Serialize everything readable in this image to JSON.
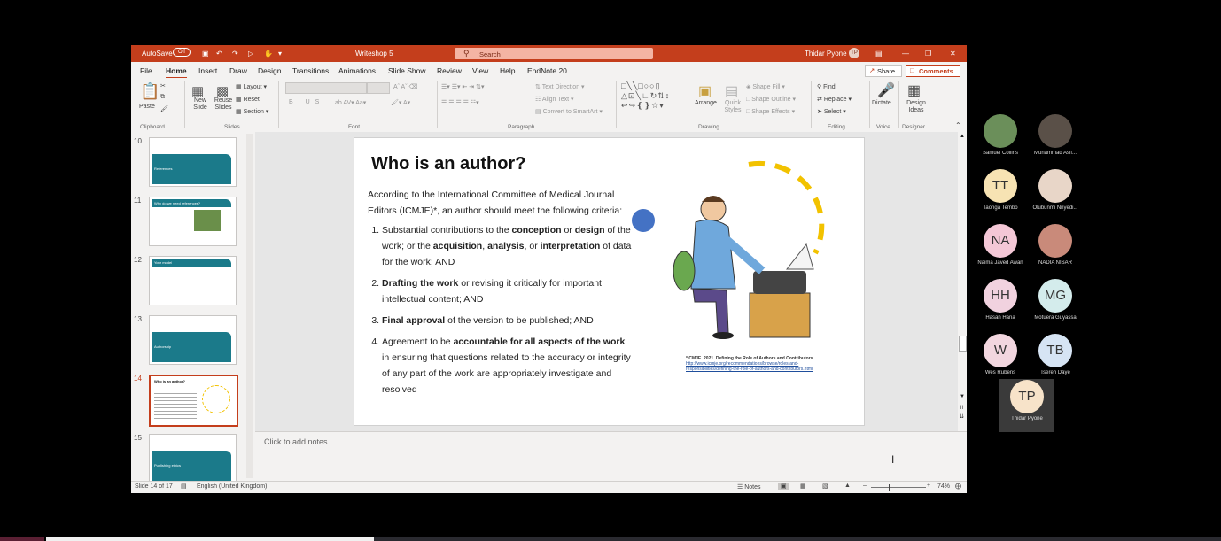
{
  "window": {
    "autosave_label": "AutoSave",
    "autosave_state": "Off",
    "doc_title": "Writeshop 5",
    "search_placeholder": "Search",
    "user_name": "Thidar Pyone",
    "user_initials": "TP"
  },
  "tabs": [
    "File",
    "Home",
    "Insert",
    "Draw",
    "Design",
    "Transitions",
    "Animations",
    "Slide Show",
    "Review",
    "View",
    "Help",
    "EndNote 20"
  ],
  "active_tab": "Home",
  "share_label": "Share",
  "comments_label": "Comments",
  "ribbon": {
    "paste": "Paste",
    "new_slide": "New Slide",
    "reuse_slides": "Reuse Slides",
    "layout": "Layout",
    "reset": "Reset",
    "section": "Section",
    "text_direction": "Text Direction",
    "align_text": "Align Text",
    "convert_smartart": "Convert to SmartArt",
    "arrange": "Arrange",
    "quick_styles": "Quick Styles",
    "shape_fill": "Shape Fill",
    "shape_outline": "Shape Outline",
    "shape_effects": "Shape Effects",
    "find": "Find",
    "replace": "Replace",
    "select": "Select",
    "dictate": "Dictate",
    "design_ideas": "Design Ideas",
    "groups": [
      "Clipboard",
      "Slides",
      "Font",
      "Paragraph",
      "Drawing",
      "Editing",
      "Voice",
      "Designer"
    ]
  },
  "thumbnails": [
    {
      "num": "10",
      "title": "References"
    },
    {
      "num": "11",
      "title": "Why do we need references?"
    },
    {
      "num": "12",
      "title": "Your model"
    },
    {
      "num": "13",
      "title": "Authorship"
    },
    {
      "num": "14",
      "title": "Who is an author?"
    },
    {
      "num": "15",
      "title": "Publishing ethics"
    }
  ],
  "slide": {
    "title": "Who is an author?",
    "intro": "According to the International Committee of Medical Journal Editors (ICMJE)*, an author should meet the following criteria:",
    "c1_a": "Substantial contributions to the ",
    "c1_b": "conception",
    "c1_c": " or ",
    "c1_d": "design",
    "c1_e": " of the work; or the ",
    "c1_f": "acquisition",
    "c1_g": ", ",
    "c1_h": "analysis",
    "c1_i": ", or ",
    "c1_j": "interpretation",
    "c1_k": " of data for the work; AND",
    "c2_a": "Drafting the work",
    "c2_b": " or revising it critically for important intellectual content; AND",
    "c3_a": "Final approval",
    "c3_b": " of the version to be published; AND",
    "c4_a": "Agreement to be ",
    "c4_b": "accountable for all aspects of the work",
    "c4_c": " in ensuring that questions related to the accuracy or integrity of any part of the work are appropriately investigate and resolved",
    "citation": "*ICMJE. 2021. Defining the Role of Authors and Contributors",
    "citation_link": "http://www.icmje.org/recommendations/browse/roles-and-responsibilities/defining-the-role-of-authors-and-contributors.html"
  },
  "notes_placeholder": "Click to add notes",
  "status": {
    "slide_counter": "Slide 14 of 17",
    "language": "English (United Kingdom)",
    "notes_label": "Notes",
    "zoom": "74%"
  },
  "participants": [
    {
      "name": "Samuel Collins",
      "initials": "",
      "bg": "#6b8f5a",
      "photo": true
    },
    {
      "name": "Muhammad Asif...",
      "initials": "",
      "bg": "#5a5048",
      "photo": true
    },
    {
      "name": "Taonga Tembo",
      "initials": "TT",
      "bg": "#f7e3b3"
    },
    {
      "name": "Olubunmi Nnyedi...",
      "initials": "",
      "bg": "#e8d6c8",
      "photo": true
    },
    {
      "name": "Naima Javed Awan",
      "initials": "NA",
      "bg": "#f4c7d6"
    },
    {
      "name": "NADIA NISAR",
      "initials": "",
      "bg": "#c98a7a",
      "photo": true
    },
    {
      "name": "Hasan Hana",
      "initials": "HH",
      "bg": "#f1d2df"
    },
    {
      "name": "Motuera Guyassa",
      "initials": "MG",
      "bg": "#d4ecec"
    },
    {
      "name": "Wes Rubens",
      "initials": "W",
      "bg": "#f2d6df"
    },
    {
      "name": "Tsereh Daye",
      "initials": "TB",
      "bg": "#d6e4f4"
    },
    {
      "name": "Thidar Pyone",
      "initials": "TP",
      "bg": "#f7e3c9"
    }
  ]
}
